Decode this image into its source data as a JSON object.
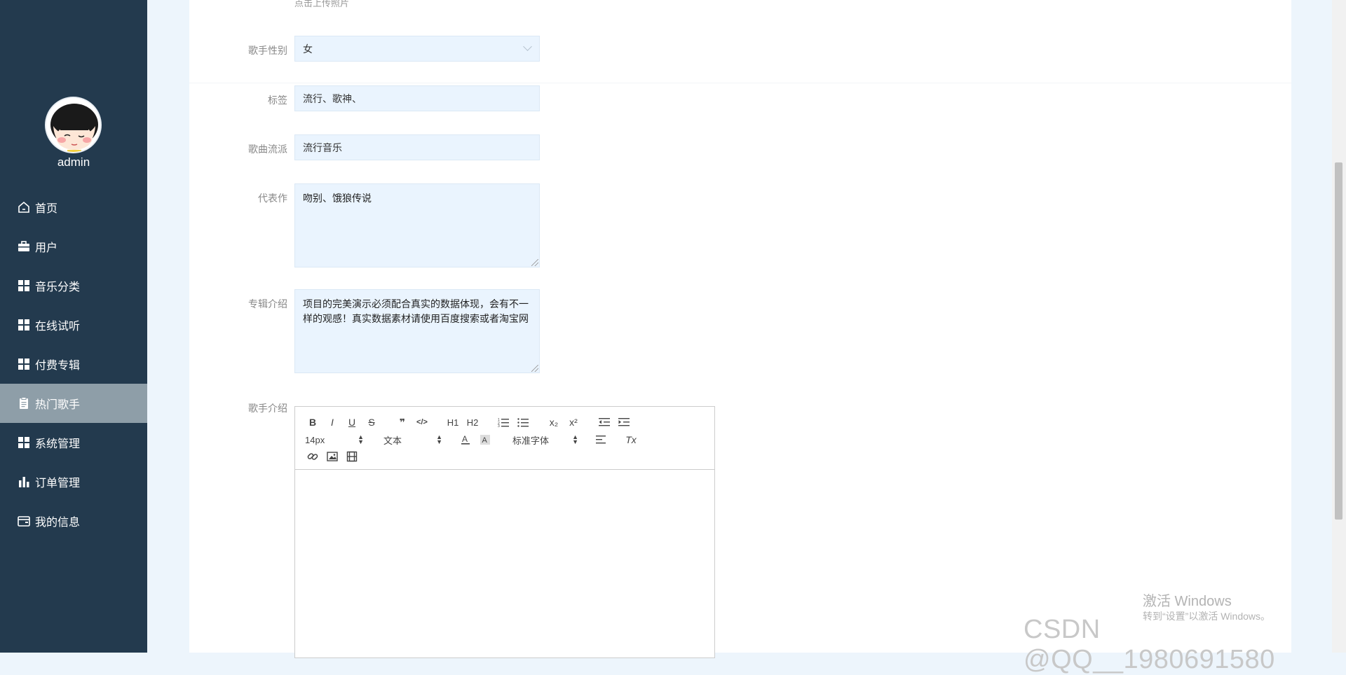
{
  "sidebar": {
    "username": "admin",
    "items": [
      {
        "label": "首页",
        "icon": "home-icon"
      },
      {
        "label": "用户",
        "icon": "briefcase-icon"
      },
      {
        "label": "音乐分类",
        "icon": "grid-icon"
      },
      {
        "label": "在线试听",
        "icon": "grid-icon"
      },
      {
        "label": "付费专辑",
        "icon": "grid-icon"
      },
      {
        "label": "热门歌手",
        "icon": "clipboard-icon",
        "active": true
      },
      {
        "label": "系统管理",
        "icon": "grid-icon"
      },
      {
        "label": "订单管理",
        "icon": "bar-chart-icon"
      },
      {
        "label": "我的信息",
        "icon": "wallet-icon"
      }
    ]
  },
  "form": {
    "upload_hint": "点击上传照片",
    "gender": {
      "label": "歌手性别",
      "value": "女"
    },
    "tags": {
      "label": "标签",
      "value": "流行、歌神、"
    },
    "genre": {
      "label": "歌曲流派",
      "value": "流行音乐"
    },
    "representative": {
      "label": "代表作",
      "value": "吻别、饿狼传说"
    },
    "album_intro": {
      "label": "专辑介绍",
      "value": "项目的完美演示必须配合真实的数据体现，会有不一样的观感！真实数据素材请使用百度搜索或者淘宝网"
    },
    "singer_intro": {
      "label": "歌手介绍"
    }
  },
  "editor": {
    "bold": "B",
    "italic": "I",
    "underline": "U",
    "strike": "S",
    "quote": "❞",
    "code": "</>",
    "h1": "H1",
    "h2": "H2",
    "sub": "x₂",
    "sup": "x²",
    "size_value": "14px",
    "type_value": "文本",
    "font_value": "标准字体",
    "clear": "Tx"
  },
  "watermarks": {
    "activate_title": "激活 Windows",
    "activate_sub": "转到“设置”以激活 Windows。",
    "csdn": "CSDN @QQ__1980691580"
  },
  "colors": {
    "sidebar_bg": "#233a4e",
    "active_item_bg": "#8e9ea8",
    "input_bg": "#eaf4fe",
    "page_bg": "#edf5fc"
  }
}
